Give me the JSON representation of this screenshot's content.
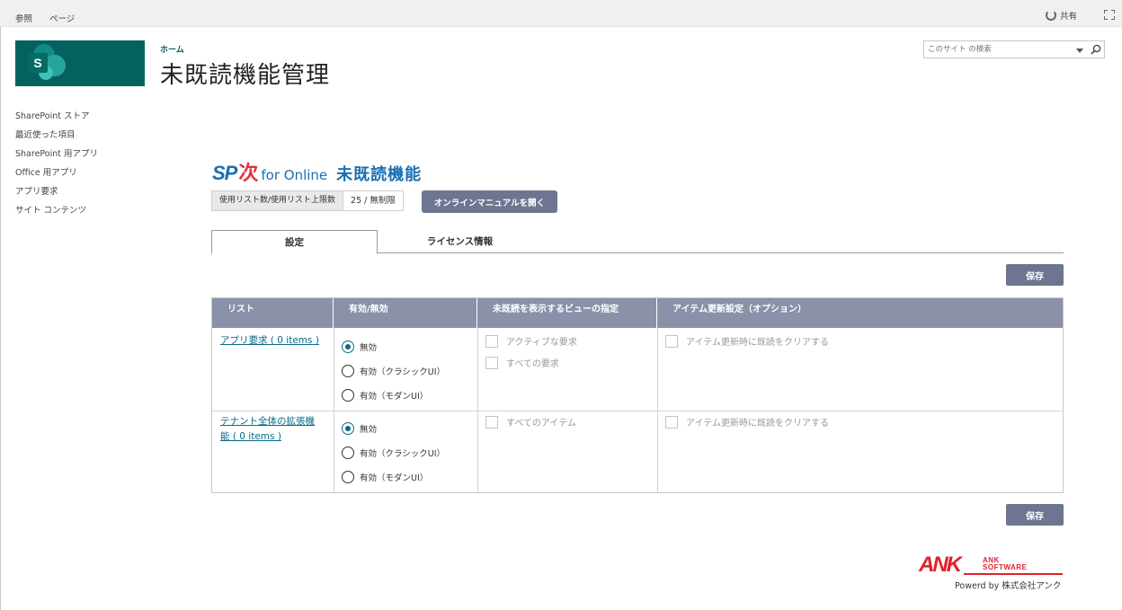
{
  "topbar": {
    "links": [
      "参照",
      "ページ"
    ],
    "share_label": "共有"
  },
  "site": {
    "logo_letter": "S",
    "breadcrumb": "ホーム",
    "title": "未既読機能管理"
  },
  "search": {
    "placeholder": "このサイト の検索"
  },
  "leftnav": {
    "items": [
      "SharePoint ストア",
      "最近使った項目",
      "SharePoint 用アプリ",
      "Office 用アプリ",
      "アプリ要求",
      "サイト コンテンツ"
    ]
  },
  "product": {
    "sp": "SP",
    "kanji": "次",
    "for_online": "for Online",
    "feature": "未既読機能"
  },
  "usage": {
    "label": "使用リスト数/使用リスト上限数",
    "value": "25 / 無制限"
  },
  "manual_button": "オンラインマニュアルを開く",
  "tabs": [
    {
      "label": "設定",
      "active": true
    },
    {
      "label": "ライセンス情報",
      "active": false
    }
  ],
  "save_label": "保存",
  "table": {
    "headers": [
      "リスト",
      "有効/無効",
      "未既読を表示するビューの指定",
      "アイテム更新設定（オプション）"
    ],
    "rows": [
      {
        "list": "アプリ要求 ( 0 items )",
        "radios": [
          "無効",
          "有効（クラシックUI）",
          "有効（モダンUI）"
        ],
        "selected": 0,
        "views": [
          "アクティブな要求",
          "すべての要求"
        ],
        "option": "アイテム更新時に既読をクリアする"
      },
      {
        "list_line1": "テナント全体の拡張機",
        "list_line2": "能 ( 0 items )",
        "radios": [
          "無効",
          "有効（クラシックUI）",
          "有効（モダンUI）"
        ],
        "selected": 0,
        "views": [
          "すべてのアイテム"
        ],
        "option": "アイテム更新時に既読をクリアする"
      }
    ]
  },
  "footer": {
    "ank": "ANK",
    "software_line1": "ANK",
    "software_line2": "SOFTWARE",
    "powered": "Powerd by 株式会社アンク"
  },
  "colors": {
    "brand_teal": "#03625d",
    "button": "#6d7590",
    "table_header": "#8a91a8",
    "link": "#0a6a86",
    "ank_red": "#e0222b"
  }
}
